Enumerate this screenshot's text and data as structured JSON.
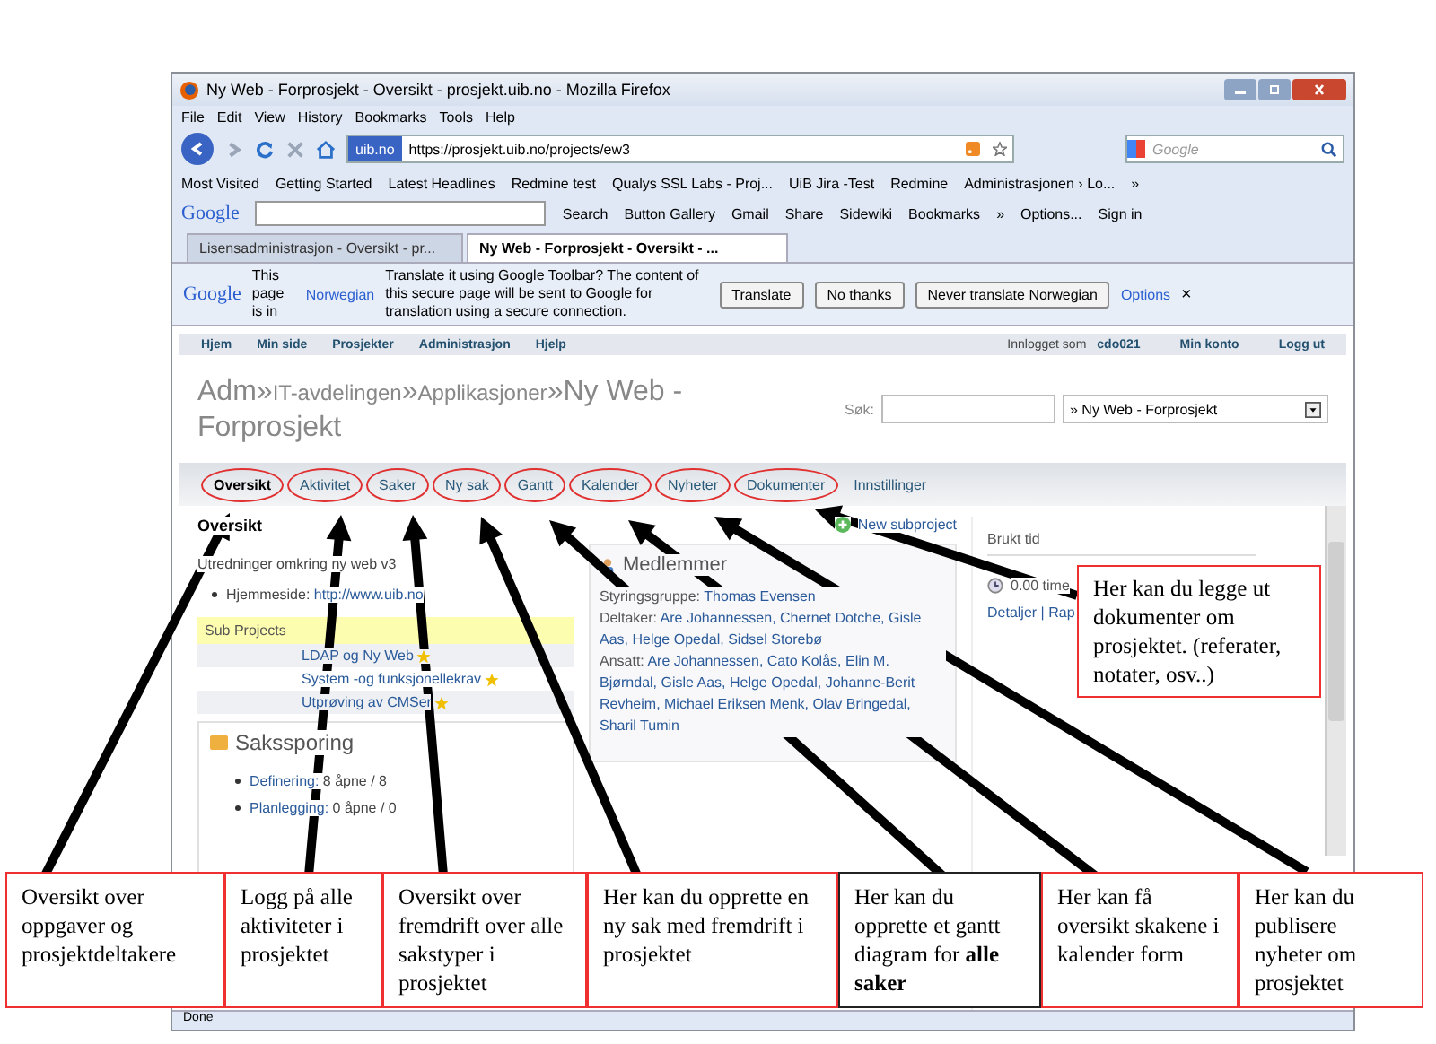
{
  "window": {
    "title": "Ny Web - Forprosjekt - Oversikt - prosjekt.uib.no - Mozilla Firefox"
  },
  "menu": [
    "File",
    "Edit",
    "View",
    "History",
    "Bookmarks",
    "Tools",
    "Help"
  ],
  "navigation": {
    "identity": "uib.no",
    "url": "https://prosjekt.uib.no/projects/ew3",
    "search_placeholder": "Google"
  },
  "bookmarks": [
    "Most Visited",
    "Getting Started",
    "Latest Headlines",
    "Redmine test",
    "Qualys SSL Labs - Proj...",
    "UiB Jira -Test",
    "Redmine",
    "Administrasjonen › Lo...",
    "»"
  ],
  "google_toolbar": {
    "logo": "Google",
    "items": [
      "Search",
      "Button Gallery",
      "Gmail",
      "Share",
      "Sidewiki",
      "Bookmarks",
      "»",
      "Options...",
      "Sign in"
    ]
  },
  "browser_tabs": [
    {
      "label": "Lisensadministrasjon - Oversikt - pr...",
      "selected": false
    },
    {
      "label": "Ny Web - Forprosjekt - Oversikt - ...",
      "selected": true
    }
  ],
  "translate_bar": {
    "logo": "Google",
    "prefix": "This page is in",
    "language": "Norwegian",
    "message": "Translate it using Google Toolbar? The content of this secure page will be sent to Google for translation using a secure connection.",
    "buttons": [
      "Translate",
      "No thanks",
      "Never translate Norwegian"
    ],
    "options": "Options",
    "close": "×"
  },
  "top_menu": {
    "items": [
      "Hjem",
      "Min side",
      "Prosjekter",
      "Administrasjon",
      "Hjelp"
    ],
    "logged_in_label": "Innlogget som",
    "user": "cdo021",
    "account": [
      "Min konto",
      "Logg ut"
    ]
  },
  "header": {
    "crumbs": [
      {
        "text": "Adm",
        "kind": "big"
      },
      {
        "text": "IT-avdelingen",
        "kind": "small"
      },
      {
        "text": "Applikasjoner",
        "kind": "small"
      },
      {
        "text": "Ny Web - Forprosjekt",
        "kind": "big"
      }
    ],
    "separator": "»",
    "search_label": "Søk:",
    "project_select": "» Ny Web - Forprosjekt"
  },
  "project_tabs": [
    {
      "label": "Oversikt",
      "selected": true,
      "circled": true
    },
    {
      "label": "Aktivitet",
      "selected": false,
      "circled": true
    },
    {
      "label": "Saker",
      "selected": false,
      "circled": true
    },
    {
      "label": "Ny sak",
      "selected": false,
      "circled": true
    },
    {
      "label": "Gantt",
      "selected": false,
      "circled": true
    },
    {
      "label": "Kalender",
      "selected": false,
      "circled": true
    },
    {
      "label": "Nyheter",
      "selected": false,
      "circled": true
    },
    {
      "label": "Dokumenter",
      "selected": false,
      "circled": true
    },
    {
      "label": "Innstillinger",
      "selected": false,
      "circled": false
    }
  ],
  "overview": {
    "heading": "Oversikt",
    "description": "Utredninger omkring ny web v3",
    "homepage_label": "Hjemmeside:",
    "homepage_link": "http://www.uib.no",
    "subprojects_heading": "Sub Projects",
    "subprojects": [
      "LDAP og Ny Web",
      "System -og funksjonellekrav",
      "Utprøving av CMSer"
    ],
    "tracking_heading": "Sakssporing",
    "tracking": [
      {
        "name": "Definering:",
        "count": "8 åpne / 8"
      },
      {
        "name": "Planlegging:",
        "count": "0 åpne / 0"
      }
    ]
  },
  "new_subproject": "New subproject",
  "members": {
    "heading": "Medlemmer",
    "groups": [
      {
        "role": "Styringsgruppe:",
        "names": "Thomas Evensen"
      },
      {
        "role": "Deltaker:",
        "names": "Are Johannessen, Chernet Dotche, Gisle Aas, Helge Opedal, Sidsel Storebø"
      },
      {
        "role": "Ansatt:",
        "names": "Are Johannessen, Cato Kolås, Elin M. Bjørndal, Gisle Aas, Helge Opedal, Johanne-Berit Revheim, Michael Eriksen Menk, Olav Bringedal, Sharil Tumin"
      }
    ]
  },
  "time": {
    "heading": "Brukt tid",
    "value": "0.00 time",
    "links": "Detaljer | Rap"
  },
  "status_bar": "Done",
  "callouts": [
    {
      "text": "Oversikt  over oppgaver  og prosjektdeltakere",
      "kind": "plain"
    },
    {
      "text": "Logg på alle aktiviteter  i prosjektet",
      "kind": "plain"
    },
    {
      "text": "Oversikt  over fremdrift  over alle sakstyper i prosjektet",
      "kind": "plain"
    },
    {
      "text": "Her kan du opprette en ny sak med fremdrift  i prosjektet",
      "kind": "plain"
    },
    {
      "text": "Her kan du opprette et gantt diagram  for **alle  saker**",
      "kind": "dark"
    },
    {
      "text": "Her kan få oversikt  skakene i kalender  form",
      "kind": "plain"
    },
    {
      "text": "Her kan du publisere nyheter  om prosjektet",
      "kind": "plain"
    }
  ],
  "side_callout": "Her kan du legge  ut dokumenter  om prosjektet. (referater, notater, osv..)"
}
